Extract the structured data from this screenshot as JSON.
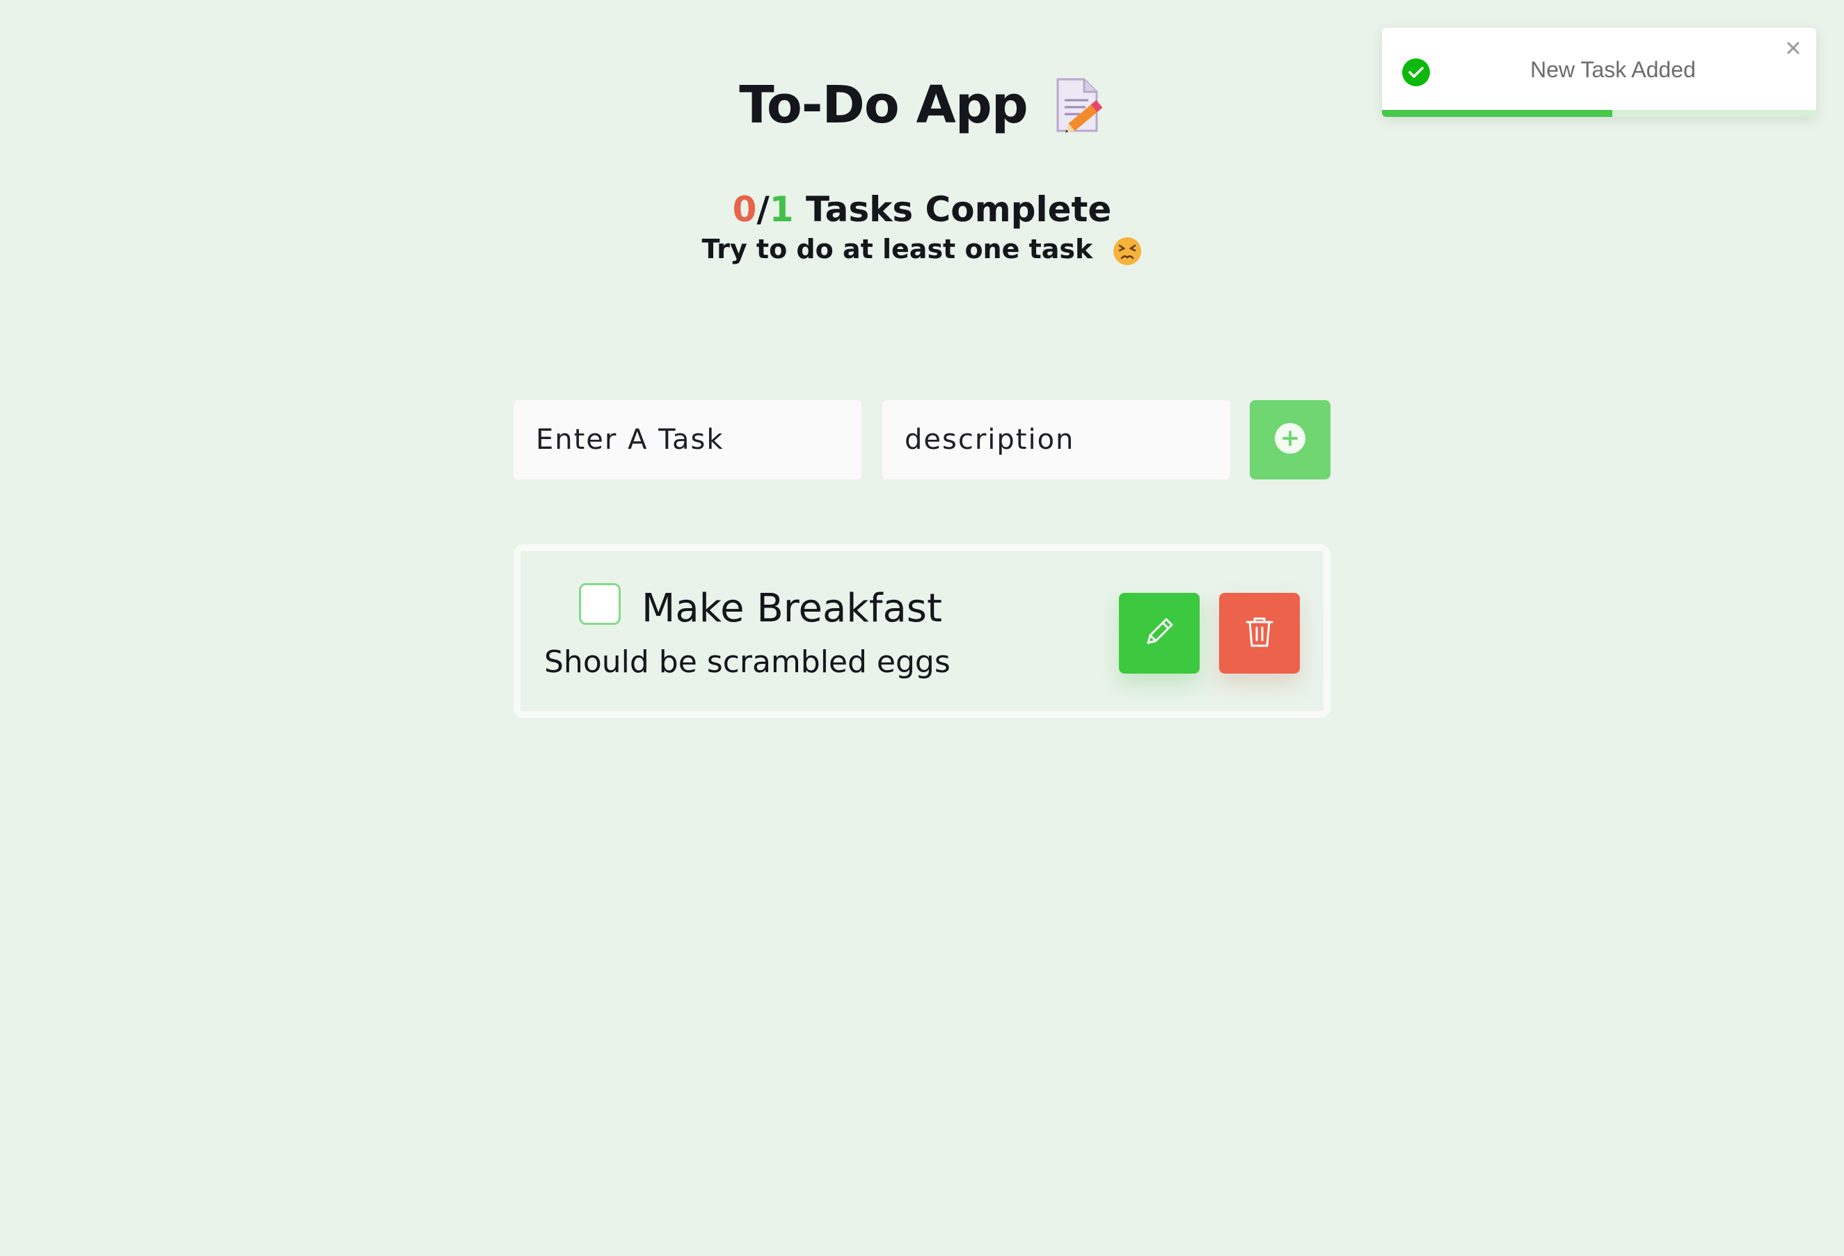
{
  "header": {
    "title": "To-Do App",
    "title_icon": "memo-pencil-icon"
  },
  "progress": {
    "completed": "0",
    "separator": "/",
    "total": "1",
    "label": " Tasks Complete",
    "subtitle": "Try to do at least one task",
    "subtitle_icon": "persevering-face-icon"
  },
  "form": {
    "task_placeholder": "Enter A Task",
    "description_placeholder": "description",
    "add_icon": "plus-circle-icon"
  },
  "tasks": [
    {
      "title": "Make Breakfast",
      "description": "Should be scrambled eggs",
      "completed": false
    }
  ],
  "toast": {
    "message": "New Task Added",
    "icon": "check-circle-icon",
    "progress_remaining": 0.53
  },
  "colors": {
    "background": "#e9f3ea",
    "accent_green": "#3cc83f",
    "add_button": "#6fd672",
    "danger": "#ec624a",
    "completed_count": "#e8634a",
    "total_count": "#43c04a"
  }
}
